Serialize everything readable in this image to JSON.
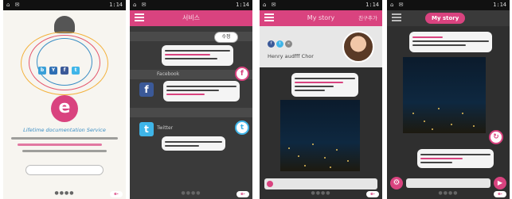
{
  "statusbar": {
    "time": "1:14",
    "left_icons": "⌂ ✉"
  },
  "screen1": {
    "tagline": "Lifetime documentation Service",
    "social_icons": [
      {
        "name": "blog-icon",
        "glyph": "b",
        "color": "#3aa0d8"
      },
      {
        "name": "yammer-icon",
        "glyph": "Y",
        "color": "#2f6fb4"
      },
      {
        "name": "facebook-icon",
        "glyph": "f",
        "color": "#3b5998"
      },
      {
        "name": "twitter-icon",
        "glyph": "t",
        "color": "#3fb5e8"
      }
    ],
    "logo_letter": "e"
  },
  "screen2": {
    "title": "서비스",
    "facebook_label": "Facebook",
    "twitter_label": "Twitter",
    "button_label": "수정"
  },
  "screen3": {
    "title": "My story",
    "right_action": "친구추가",
    "profile_name": "Henry audfff Chor",
    "profile_icons": [
      {
        "name": "facebook-icon",
        "glyph": "f",
        "color": "#3b5998"
      },
      {
        "name": "twitter-icon",
        "glyph": "t",
        "color": "#3fb5e8"
      },
      {
        "name": "link-icon",
        "glyph": "∞",
        "color": "#888888"
      }
    ]
  },
  "screen4": {
    "title": "My story"
  },
  "nav_dots": "●●●●",
  "corner_logo": "e-",
  "accent": "#d9437f"
}
